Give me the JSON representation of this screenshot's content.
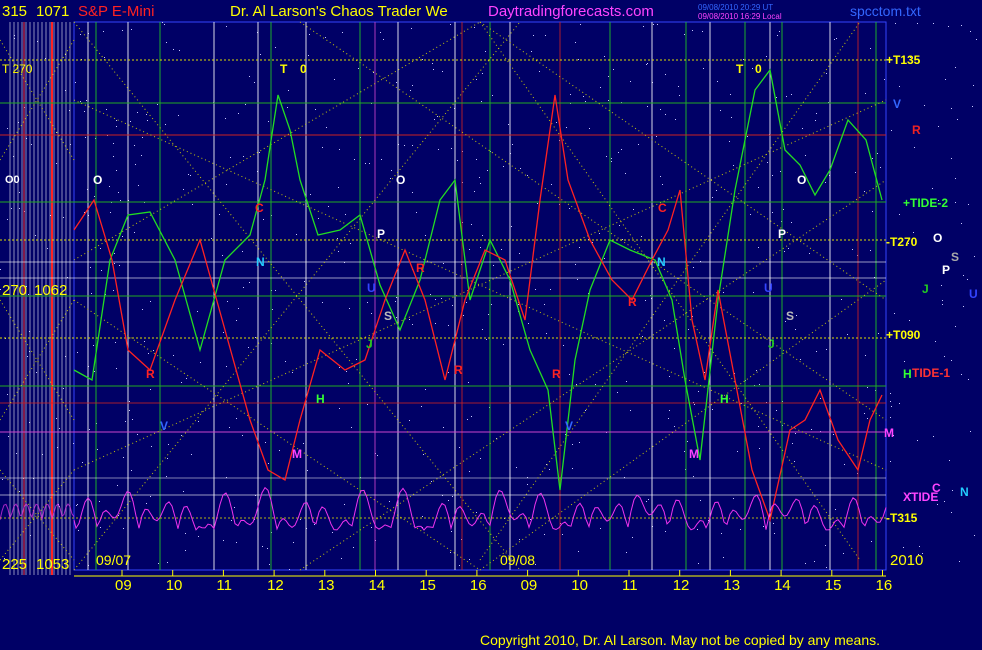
{
  "header": {
    "price_high": "315",
    "price_high_value": "1071",
    "symbol": "S&P E-Mini",
    "title": "Dr. Al Larson's Chaos Trader We",
    "website": "Daytradingforecasts.com",
    "filename": "spcctom.txt",
    "timestamp_ut": "09/08/2010 20:29 UT",
    "timestamp_local": "09/08/2010 16:29 Local"
  },
  "left_labels": {
    "t270": "T 270",
    "o_marker": "O0",
    "mid_label": "270",
    "mid_value": "1062",
    "low_label": "225",
    "low_value": "1053"
  },
  "chart_data": {
    "type": "line",
    "title": "S&P E-Mini",
    "days": [
      "09/07",
      "09/08"
    ],
    "year": "2010",
    "x_ticks": [
      "09",
      "10",
      "11",
      "12",
      "13",
      "14",
      "15",
      "16",
      "09",
      "10",
      "11",
      "12",
      "13",
      "14",
      "15",
      "16"
    ],
    "ylim": [
      1053,
      1071
    ],
    "y_markers": [
      {
        "label": "315",
        "value": 1071
      },
      {
        "label": "270",
        "value": 1062
      },
      {
        "label": "225",
        "value": 1053
      }
    ],
    "series": [
      {
        "name": "TIDE-2",
        "color": "#22dd22"
      },
      {
        "name": "TIDE-1",
        "color": "#ff2222"
      },
      {
        "name": "XTIDE",
        "color": "#ee33ee"
      }
    ],
    "right_labels": [
      {
        "text": "+T135",
        "color": "#ffff00"
      },
      {
        "text": "V",
        "color": "#3366ff"
      },
      {
        "text": "R",
        "color": "#ee2222"
      },
      {
        "text": "+TIDE-2",
        "color": "#33ff33"
      },
      {
        "text": "-T270",
        "color": "#ffff00"
      },
      {
        "text": "O",
        "color": "#ffffff"
      },
      {
        "text": "S",
        "color": "#aaaaaa"
      },
      {
        "text": "P",
        "color": "#ffffff"
      },
      {
        "text": "J",
        "color": "#22cc22"
      },
      {
        "text": "U",
        "color": "#3344ff"
      },
      {
        "text": "+T090",
        "color": "#ffff00"
      },
      {
        "text": "H",
        "color": "#33ff33"
      },
      {
        "text": "TIDE-1",
        "color": "#ff3333"
      },
      {
        "text": "M",
        "color": "#ff44ff"
      },
      {
        "text": "C",
        "color": "#ff44ff"
      },
      {
        "text": "N",
        "color": "#22ccff"
      },
      {
        "text": "XTIDE",
        "color": "#ff44ff"
      },
      {
        "text": "-T315",
        "color": "#ffff00"
      }
    ],
    "in_chart_labels": [
      {
        "text": "O",
        "color": "#ffffff"
      },
      {
        "text": "T",
        "color": "#ffff00"
      },
      {
        "text": "0",
        "color": "#ffff00"
      },
      {
        "text": "C",
        "color": "#ff2222"
      },
      {
        "text": "N",
        "color": "#22ccff"
      },
      {
        "text": "P",
        "color": "#ffffff"
      },
      {
        "text": "S",
        "color": "#bbbbbb"
      },
      {
        "text": "J",
        "color": "#22cc22"
      },
      {
        "text": "H",
        "color": "#33ff33"
      },
      {
        "text": "M",
        "color": "#ff44ff"
      },
      {
        "text": "R",
        "color": "#ff2222"
      },
      {
        "text": "V",
        "color": "#3366ff"
      },
      {
        "text": "U",
        "color": "#3344ff"
      }
    ],
    "grid": true
  },
  "footer": {
    "copyright": "Copyright 2010, Dr. Al Larson. May not be copied by any means."
  },
  "colors": {
    "background": "#000066",
    "grid_yellow": "#dddd00",
    "grid_green": "#22aa22"
  }
}
